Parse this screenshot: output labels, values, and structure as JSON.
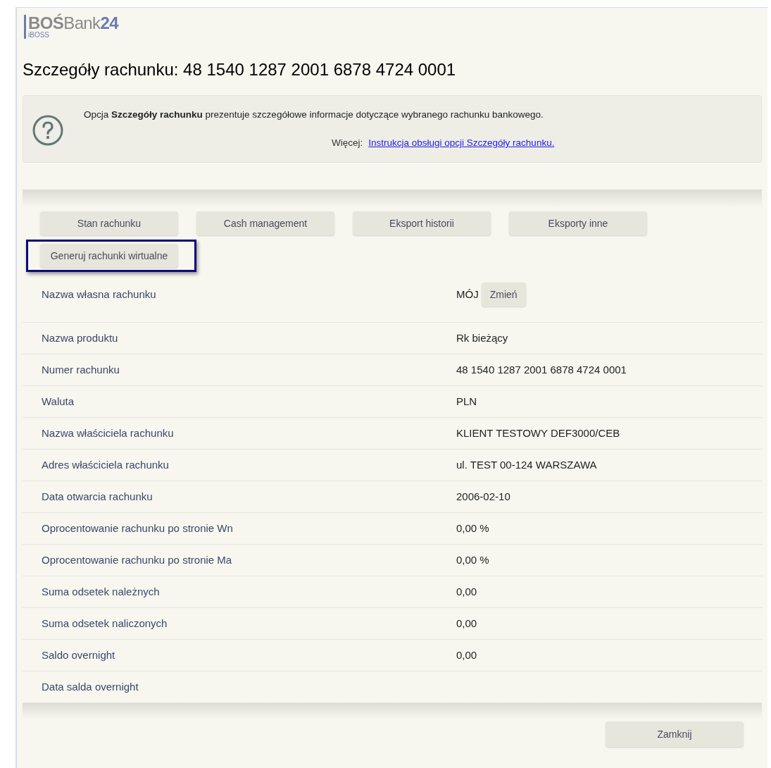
{
  "logo": {
    "brand_main": "BOŚ",
    "brand_bank": "Bank",
    "brand_num": "24",
    "brand_sub": "iBOSS"
  },
  "page_title": "Szczegóły rachunku: 48 1540 1287 2001 6878 4724 0001",
  "help": {
    "text": "Opcja **Szczegóły rachunku** prezentuje szczegółowe informacje dotyczące wybranego rachunku bankowego.",
    "more_label": "Więcej:",
    "link": "Instrukcja obsługi opcji Szczegóły rachunku."
  },
  "action_buttons": [
    {
      "label": "Stan rachunku",
      "highlighted": false
    },
    {
      "label": "Cash management",
      "highlighted": false
    },
    {
      "label": "Eksport historii",
      "highlighted": false
    },
    {
      "label": "Eksporty inne",
      "highlighted": false
    },
    {
      "label": "Generuj rachunki wirtualne",
      "highlighted": true
    }
  ],
  "details": [
    {
      "label": "Nazwa własna rachunku",
      "value": "MÓJ",
      "button": "Zmień"
    },
    {
      "label": "Nazwa produktu",
      "value": "Rk bieżący"
    },
    {
      "label": "Numer rachunku",
      "value": "48 1540 1287 2001 6878 4724 0001"
    },
    {
      "label": "Waluta",
      "value": "PLN"
    },
    {
      "label": "Nazwa właściciela rachunku",
      "value": "KLIENT TESTOWY DEF3000/CEB"
    },
    {
      "label": "Adres właściciela rachunku",
      "value": "ul. TEST 00-124 WARSZAWA"
    },
    {
      "label": "Data otwarcia rachunku",
      "value": "2006-02-10"
    },
    {
      "label": "Oprocentowanie rachunku po stronie Wn",
      "value": "0,00 %"
    },
    {
      "label": "Oprocentowanie rachunku po stronie Ma",
      "value": "0,00 %"
    },
    {
      "label": "Suma odsetek należnych",
      "value": "0,00"
    },
    {
      "label": "Suma odsetek naliczonych",
      "value": "0,00"
    },
    {
      "label": "Saldo overnight",
      "value": "0,00"
    },
    {
      "label": "Data salda overnight"
    }
  ],
  "close_button": "Zamknij"
}
